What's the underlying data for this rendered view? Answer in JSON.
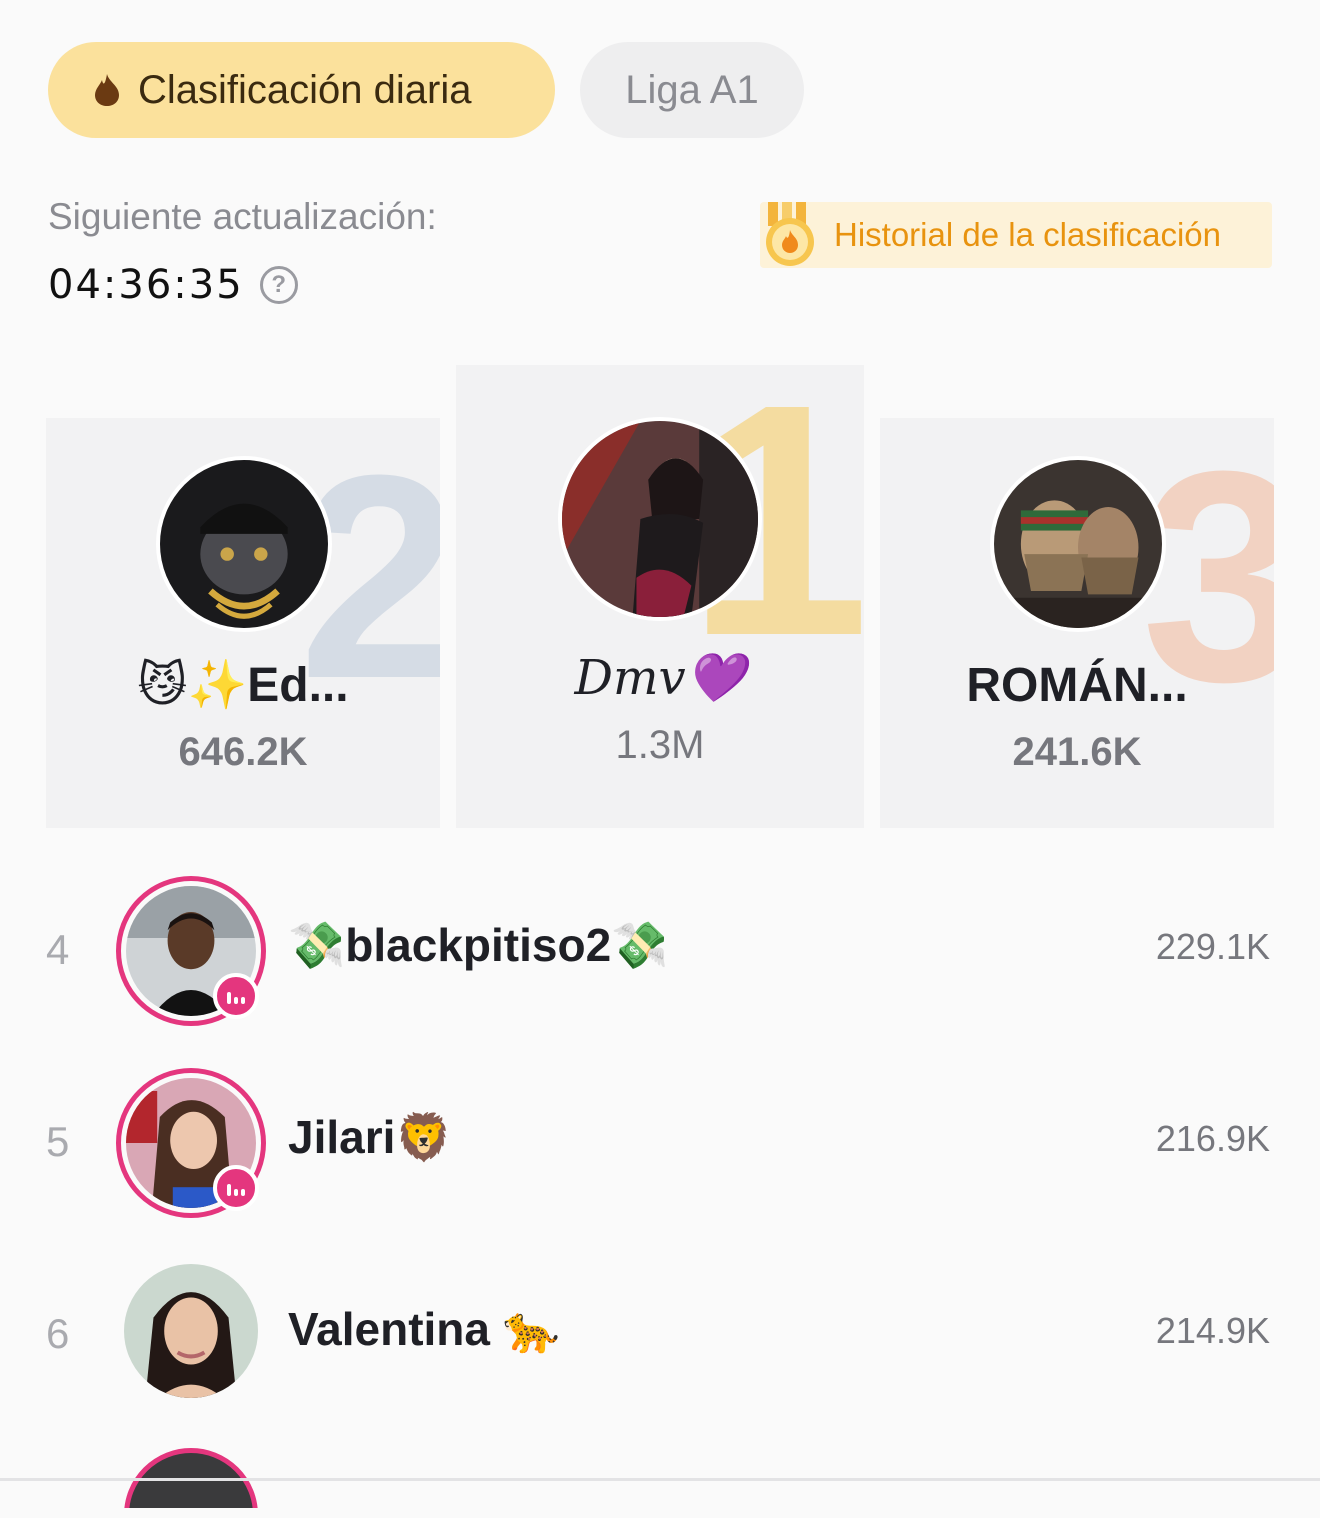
{
  "tabs": {
    "daily": "Clasificación diaria",
    "league": "Liga A1"
  },
  "update": {
    "label": "Siguiente actualización:",
    "countdown": "04:36:35",
    "help_icon": "?"
  },
  "history_button": "Historial de la clasificación",
  "podium": [
    {
      "rank": "2",
      "name": "😼✨Ed...",
      "score": "646.2K"
    },
    {
      "rank": "1",
      "name": "Dmv💜",
      "score": "1.3M"
    },
    {
      "rank": "3",
      "name": "ROMÁN...",
      "score": "241.6K"
    }
  ],
  "list": [
    {
      "rank": "4",
      "name": "💸blackpitiso2💸",
      "score": "229.1K",
      "live": true
    },
    {
      "rank": "5",
      "name": "Jilari🦁",
      "score": "216.9K",
      "live": true
    },
    {
      "rank": "6",
      "name": "Valentina 🐆",
      "score": "214.9K",
      "live": false
    }
  ],
  "colors": {
    "accent_tab": "#fbe19c",
    "history_text": "#e8930f",
    "live_ring": "#e4367e"
  }
}
